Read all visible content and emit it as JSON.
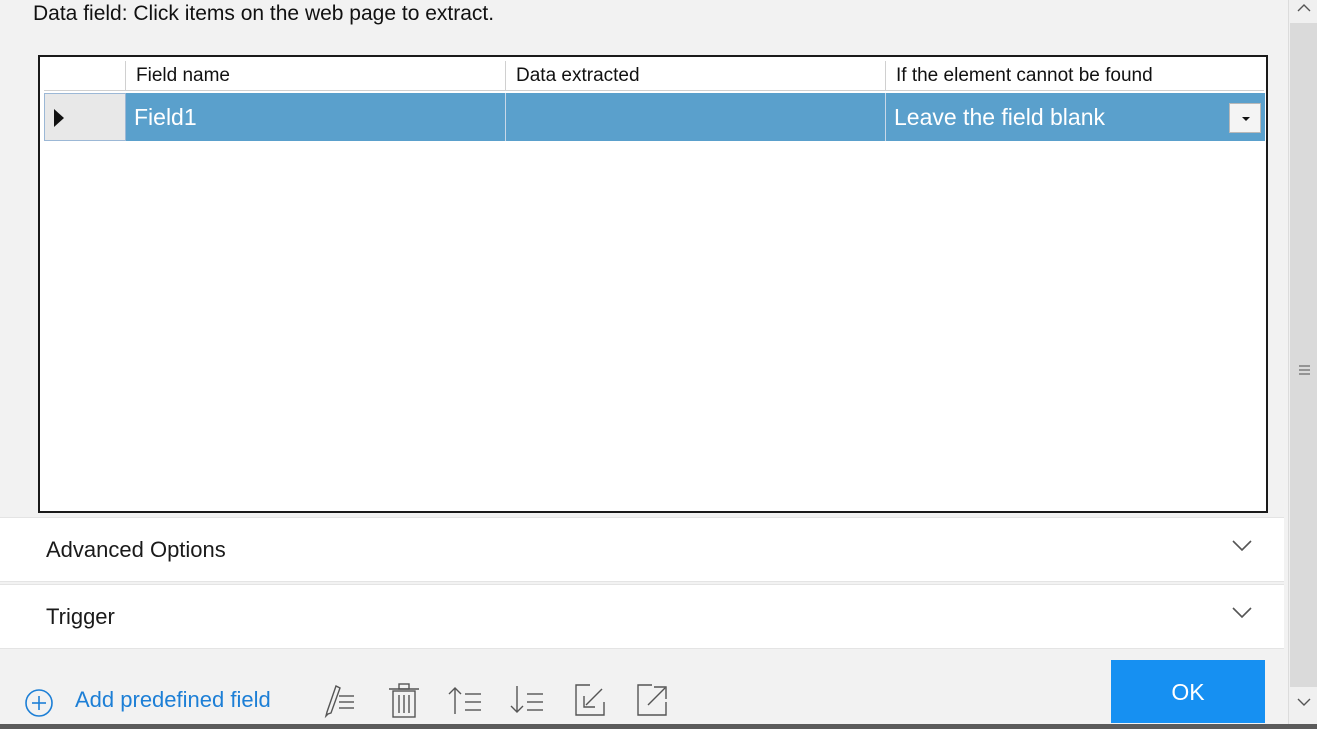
{
  "heading": "Data field: Click items on the web page to extract.",
  "grid": {
    "columns": [
      "Field name",
      "Data extracted",
      "If the element cannot be found"
    ],
    "rows": [
      {
        "field_name": "Field1",
        "data_extracted": "",
        "if_not_found": "Leave the field blank"
      }
    ],
    "selected_row_color": "#5aa0cc"
  },
  "accordions": [
    {
      "label": "Advanced Options"
    },
    {
      "label": "Trigger"
    }
  ],
  "toolbar": {
    "add_label": "Add predefined field",
    "icons": [
      "edit-list-icon",
      "trash-icon",
      "move-up-icon",
      "move-down-icon",
      "import-icon",
      "export-icon"
    ]
  },
  "ok_label": "OK",
  "colors": {
    "accent": "#1690f2",
    "link": "#1d7fd6"
  }
}
